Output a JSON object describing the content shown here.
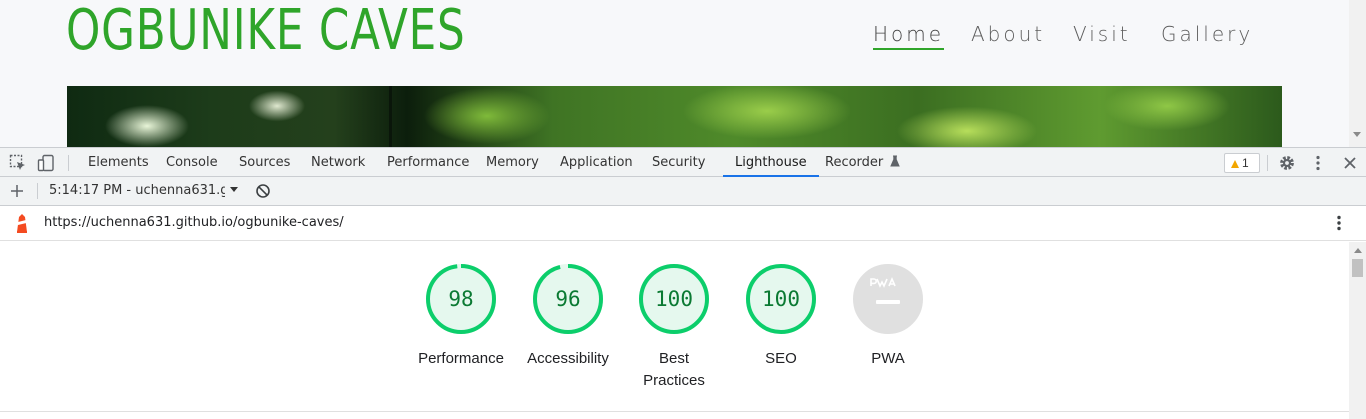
{
  "site": {
    "title": "OGBUNIKE CAVES",
    "nav": [
      "Home",
      "About",
      "Visit",
      "Gallery"
    ],
    "active_nav": "Home"
  },
  "devtools": {
    "tabs": [
      "Elements",
      "Console",
      "Sources",
      "Network",
      "Performance",
      "Memory",
      "Application",
      "Security",
      "Lighthouse",
      "Recorder"
    ],
    "active_tab": "Lighthouse",
    "warning_count": "1",
    "icons": [
      "inspect-element-icon",
      "device-toolbar-icon",
      "settings-icon",
      "more-options-icon",
      "close-icon"
    ]
  },
  "lighthouse": {
    "report_selector": "5:14:17 PM - uchenna631.githu",
    "url": "https://uchenna631.github.io/ogbunike-caves/",
    "categories": [
      {
        "label": "Performance",
        "score": "98",
        "fraction": 0.98
      },
      {
        "label": "Accessibility",
        "score": "96",
        "fraction": 0.96
      },
      {
        "label": "Best Practices",
        "score": "100",
        "fraction": 1.0
      },
      {
        "label": "SEO",
        "score": "100",
        "fraction": 1.0
      },
      {
        "label": "PWA",
        "score": "",
        "fraction": 0
      }
    ],
    "colors": {
      "pass": "#0cce6b",
      "pass_fill": "#e5f8ee",
      "pass_text": "#0b7a33",
      "na": "#e0e0e0"
    }
  }
}
